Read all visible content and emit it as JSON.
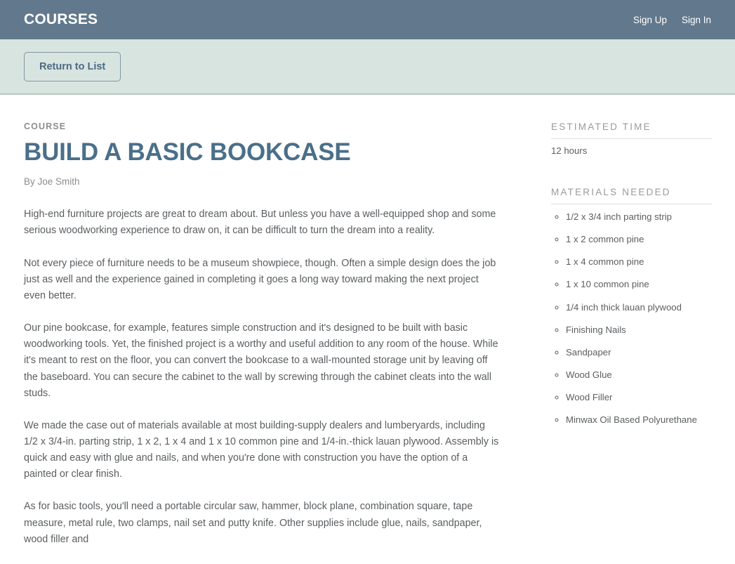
{
  "header": {
    "brand": "COURSES",
    "links": [
      {
        "label": "Sign Up"
      },
      {
        "label": "Sign In"
      }
    ]
  },
  "subheader": {
    "return_button": "Return to List"
  },
  "article": {
    "eyebrow": "COURSE",
    "title": "BUILD A BASIC BOOKCASE",
    "byline": "By Joe Smith",
    "paragraphs": [
      "High-end furniture projects are great to dream about. But unless you have a well-equipped shop and some serious woodworking experience to draw on, it can be difficult to turn the dream into a reality.",
      "Not every piece of furniture needs to be a museum showpiece, though. Often a simple design does the job just as well and the experience gained in completing it goes a long way toward making the next project even better.",
      "Our pine bookcase, for example, features simple construction and it's designed to be built with basic woodworking tools. Yet, the finished project is a worthy and useful addition to any room of the house. While it's meant to rest on the floor, you can convert the bookcase to a wall-mounted storage unit by leaving off the baseboard. You can secure the cabinet to the wall by screwing through the cabinet cleats into the wall studs.",
      "We made the case out of materials available at most building-supply dealers and lumberyards, including 1/2 x 3/4-in. parting strip, 1 x 2, 1 x 4 and 1 x 10 common pine and 1/4-in.-thick lauan plywood. Assembly is quick and easy with glue and nails, and when you're done with construction you have the option of a painted or clear finish.",
      "As for basic tools, you'll need a portable circular saw, hammer, block plane, combination square, tape measure, metal rule, two clamps, nail set and putty knife. Other supplies include glue, nails, sandpaper, wood filler and"
    ]
  },
  "sidebar": {
    "estimated_time_heading": "ESTIMATED TIME",
    "estimated_time_value": "12 hours",
    "materials_heading": "MATERIALS NEEDED",
    "materials": [
      "1/2 x 3/4 inch parting strip",
      "1 x 2 common pine",
      "1 x 4 common pine",
      "1 x 10 common pine",
      "1/4 inch thick lauan plywood",
      "Finishing Nails",
      "Sandpaper",
      "Wood Glue",
      "Wood Filler",
      "Minwax Oil Based Polyurethane"
    ]
  },
  "colors": {
    "navbar": "#62798d",
    "subheader": "#d8e4df",
    "title": "#4a6f8a",
    "body_text": "#5a5e61",
    "muted": "#8d8d8d"
  }
}
